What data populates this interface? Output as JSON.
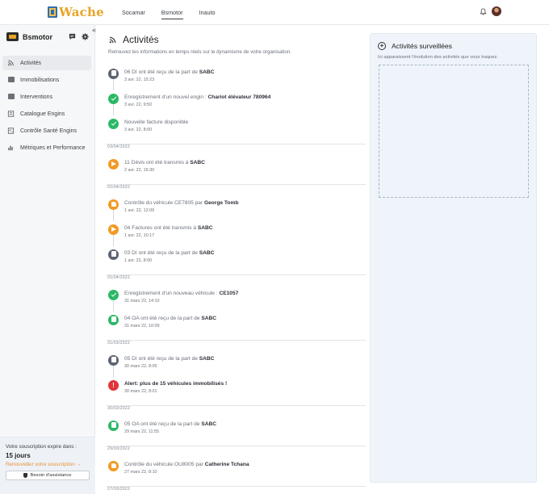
{
  "header": {
    "logo_text": "Wache",
    "tabs": [
      {
        "label": "Socamar",
        "active": false
      },
      {
        "label": "Bsmotor",
        "active": true
      },
      {
        "label": "Inauto",
        "active": false
      }
    ],
    "icons": [
      "bell-icon",
      "avatar"
    ]
  },
  "sidebar": {
    "company": "Bsmotor",
    "collapse_glyph": "«",
    "items": [
      {
        "label": "Activités",
        "icon": "rss-icon",
        "active": true
      },
      {
        "label": "Immobilisations",
        "icon": "truck-icon",
        "active": false
      },
      {
        "label": "Interventions",
        "icon": "briefcase-icon",
        "active": false
      },
      {
        "label": "Catalogue Engins",
        "icon": "catalog-icon",
        "active": false
      },
      {
        "label": "Contrôle Santé Engins",
        "icon": "checklist-icon",
        "active": false
      },
      {
        "label": "Métriques et Performance",
        "icon": "bar-chart-icon",
        "active": false
      }
    ],
    "subscription": {
      "label": "Votre souscription expire dans :",
      "days": "15 jours",
      "renew_link": "Renouvellez votre souscription →",
      "help_button": "Besoin d'assistance"
    }
  },
  "main": {
    "title": "Activités",
    "subtitle": "Retrouvez les informations en temps réels sur le dynamisme de votre organisation.",
    "feed": [
      {
        "kind": "entry",
        "type": "gray",
        "icon": "document-icon",
        "pre": "06 DI ont été reçu de la part de ",
        "bold": "SABC",
        "time": "3 avr. 22, 15:23"
      },
      {
        "kind": "entry",
        "type": "green",
        "icon": "check-icon",
        "pre": "Enregistrement d'un nouvel engin : ",
        "bold": "Chariot élévateur 780964",
        "time": "3 avr. 22, 9:50"
      },
      {
        "kind": "entry",
        "type": "green",
        "icon": "check-icon",
        "pre": "Nouvelle facture disponible",
        "bold": "",
        "time": "3 avr. 22, 8:00"
      },
      {
        "kind": "sep",
        "date": "03/04/2022"
      },
      {
        "kind": "entry",
        "type": "orange",
        "icon": "send-icon",
        "pre": "11 Dévis ont été transmis à ",
        "bold": "SABC",
        "time": "2 avr. 22, 16:30"
      },
      {
        "kind": "sep",
        "date": "02/04/2022"
      },
      {
        "kind": "entry",
        "type": "orange",
        "icon": "thumbs-up-icon",
        "pre": "Contrôle du véhicule CE7805 par ",
        "bold": "George Tomb",
        "time": "1 avr. 22, 12:09"
      },
      {
        "kind": "entry",
        "type": "orange",
        "icon": "send-icon",
        "pre": "04 Factures ont été transmis à ",
        "bold": "SABC",
        "time": "1 avr. 22, 10:17"
      },
      {
        "kind": "entry",
        "type": "gray",
        "icon": "document-icon",
        "pre": "03 DI ont été reçu de la part de ",
        "bold": "SABC",
        "time": "1 avr. 22, 8:00"
      },
      {
        "kind": "sep",
        "date": "01/04/2022"
      },
      {
        "kind": "entry",
        "type": "green",
        "icon": "check-icon",
        "pre": "Enregistrement d'un nouveau véhicule : ",
        "bold": "CE1057",
        "time": "31 mars 22, 14:10"
      },
      {
        "kind": "entry",
        "type": "green",
        "icon": "document-icon",
        "pre": "04 OA ont été reçu de la part de ",
        "bold": "SABC",
        "time": "31 mars 22, 10:09"
      },
      {
        "kind": "sep",
        "date": "31/03/2022"
      },
      {
        "kind": "entry",
        "type": "gray",
        "icon": "document-icon",
        "pre": "05 DI ont été reçu de la part de ",
        "bold": "SABC",
        "time": "30 mars 22, 8:05"
      },
      {
        "kind": "entry",
        "type": "red",
        "icon": "alert-icon",
        "pre": "",
        "bold": "Alert: plus de 15 véhicules immobilisés !",
        "strong": true,
        "time": "30 mars 22, 8:01"
      },
      {
        "kind": "sep",
        "date": "30/03/2022"
      },
      {
        "kind": "entry",
        "type": "green",
        "icon": "document-icon",
        "pre": "05 OA ont été reçu de la part de ",
        "bold": "SABC",
        "time": "29 mars 22, 11:55"
      },
      {
        "kind": "sep",
        "date": "29/03/2022"
      },
      {
        "kind": "entry",
        "type": "orange",
        "icon": "thumbs-up-icon",
        "pre": "Contrôle du véhicule OU8005 par ",
        "bold": "Catherine Tchana",
        "time": "27 mars 22, 8:10"
      },
      {
        "kind": "sep",
        "date": "27/03/2022"
      }
    ]
  },
  "panel": {
    "title": "Activités surveillées",
    "subtitle": "Ici apparaissent l'évolution des activités que vous traquez."
  },
  "colors": {
    "accent": "#e8a425",
    "gray": "#5c6470",
    "green": "#2cb866",
    "orange": "#f29a23",
    "red": "#e0353a",
    "panel_bg": "#eef4fa"
  }
}
